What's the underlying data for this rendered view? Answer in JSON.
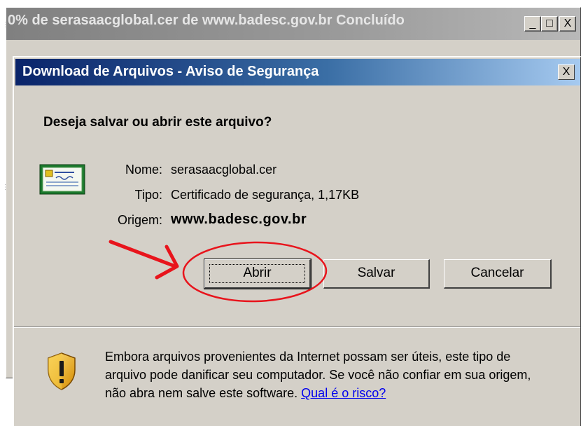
{
  "background_window": {
    "title": "0% de serasaacglobal.cer de www.badesc.gov.br Concluído",
    "buttons": {
      "minimize": "_",
      "maximize": "□",
      "close": "X"
    }
  },
  "dialog": {
    "title": "Download de Arquivos - Aviso de Segurança",
    "close_label": "X",
    "question": "Deseja salvar ou abrir este arquivo?",
    "file": {
      "name_label": "Nome:",
      "name_value": "serasaacglobal.cer",
      "type_label": "Tipo:",
      "type_value": "Certificado de segurança, 1,17KB",
      "origin_label": "Origem:",
      "origin_value": "www.badesc.gov.br"
    },
    "buttons": {
      "open": "Abrir",
      "save": "Salvar",
      "cancel": "Cancelar"
    },
    "warning": {
      "text": "Embora arquivos provenientes da Internet possam ser úteis, este tipo de arquivo pode danificar seu computador. Se você não confiar em sua origem, não abra nem salve este software.",
      "link": "Qual é o risco?"
    }
  },
  "colors": {
    "dialog_titlebar": "#0a246a",
    "annotation_red": "#e8141c",
    "link": "#0000ee"
  },
  "icons": {
    "file": "certificate-icon",
    "warning": "security-shield-icon",
    "annotation": "red-arrow-and-circle"
  }
}
